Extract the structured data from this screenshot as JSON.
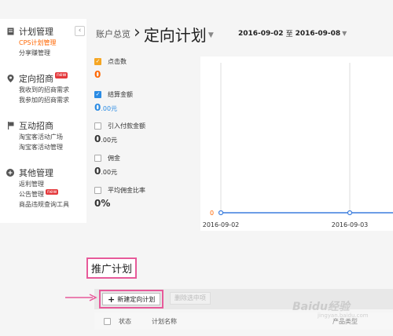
{
  "sidebar": {
    "collapse_glyph": "‹",
    "sections": [
      {
        "title": "计划管理",
        "icon": "document-icon",
        "items": [
          {
            "label": "CPS计划管理",
            "active": true
          },
          {
            "label": "分享赚管理",
            "active": false
          }
        ]
      },
      {
        "title": "定向招商",
        "icon": "location-pin-icon",
        "badge": "new",
        "items": [
          {
            "label": "我收到的招商需求"
          },
          {
            "label": "我参加的招商需求"
          }
        ]
      },
      {
        "title": "互动招商",
        "icon": "flag-icon",
        "items": [
          {
            "label": "淘宝客活动广场"
          },
          {
            "label": "淘宝客活动管理"
          }
        ]
      },
      {
        "title": "其他管理",
        "icon": "plus-circle-icon",
        "items": [
          {
            "label": "返利管理"
          },
          {
            "label": "公告管理",
            "badge": "new"
          },
          {
            "label": "商品违规查询工具"
          }
        ]
      }
    ]
  },
  "header": {
    "breadcrumb_root": "账户总览",
    "breadcrumb_sep": "›",
    "title": "定向计划",
    "date_start": "2016-09-02",
    "date_sep": "至",
    "date_end": "2016-09-08"
  },
  "metrics": [
    {
      "label": "点击数",
      "value": "0",
      "unit": "",
      "checked": "orange",
      "value_color": "orange"
    },
    {
      "label": "结算金额",
      "value": "0",
      "unit": ".00元",
      "checked": "blue",
      "value_color": "blue"
    },
    {
      "label": "引入付款金额",
      "value": "0",
      "unit": ".00元",
      "checked": "none",
      "value_color": "dark"
    },
    {
      "label": "佣金",
      "value": "0",
      "unit": ".00元",
      "checked": "none",
      "value_color": "dark"
    },
    {
      "label": "平均佣金比率",
      "value": "0%",
      "unit": "",
      "checked": "none",
      "value_color": "dark"
    }
  ],
  "chart_data": {
    "type": "line",
    "x": [
      "2016-09-02",
      "2016-09-03"
    ],
    "series": [
      {
        "values": [
          0,
          0
        ],
        "color": "#3b7ddd"
      }
    ],
    "y_axis_label": "0",
    "y_axis_color": "#f60"
  },
  "section": {
    "title": "推广计划",
    "new_plan_button": "新建定向计划",
    "delete_button": "删除选中项"
  },
  "table": {
    "headers": [
      "状态",
      "计划名称",
      "产品类型"
    ]
  },
  "colors": {
    "accent_orange": "#f60",
    "accent_blue": "#2a8be4",
    "annotation_pink": "#e75a9a"
  },
  "watermark": {
    "text": "Baidu经验",
    "sub": "jingyan.baidu.com"
  }
}
